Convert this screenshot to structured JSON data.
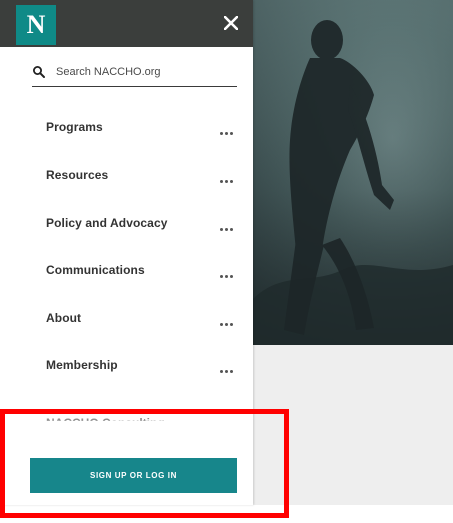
{
  "header": {
    "logo_letter": "N",
    "logo_color": "#0f8a87",
    "header_bg": "#3b3e3c",
    "close_icon": "close-icon"
  },
  "search": {
    "placeholder": "Search NACCHO.org",
    "value": "",
    "icon": "search-icon"
  },
  "nav": {
    "items": [
      {
        "label": "Programs",
        "more_icon": "ellipsis-icon"
      },
      {
        "label": "Resources",
        "more_icon": "ellipsis-icon"
      },
      {
        "label": "Policy and Advocacy",
        "more_icon": "ellipsis-icon"
      },
      {
        "label": "Communications",
        "more_icon": "ellipsis-icon"
      },
      {
        "label": "About",
        "more_icon": "ellipsis-icon"
      },
      {
        "label": "Membership",
        "more_icon": "ellipsis-icon"
      }
    ],
    "partial_item_label": "NACCHO Consulting"
  },
  "cta": {
    "signup_label": "SIGN UP OR LOG IN",
    "color": "#17868b"
  },
  "annotation": {
    "color": "#ff0000"
  }
}
